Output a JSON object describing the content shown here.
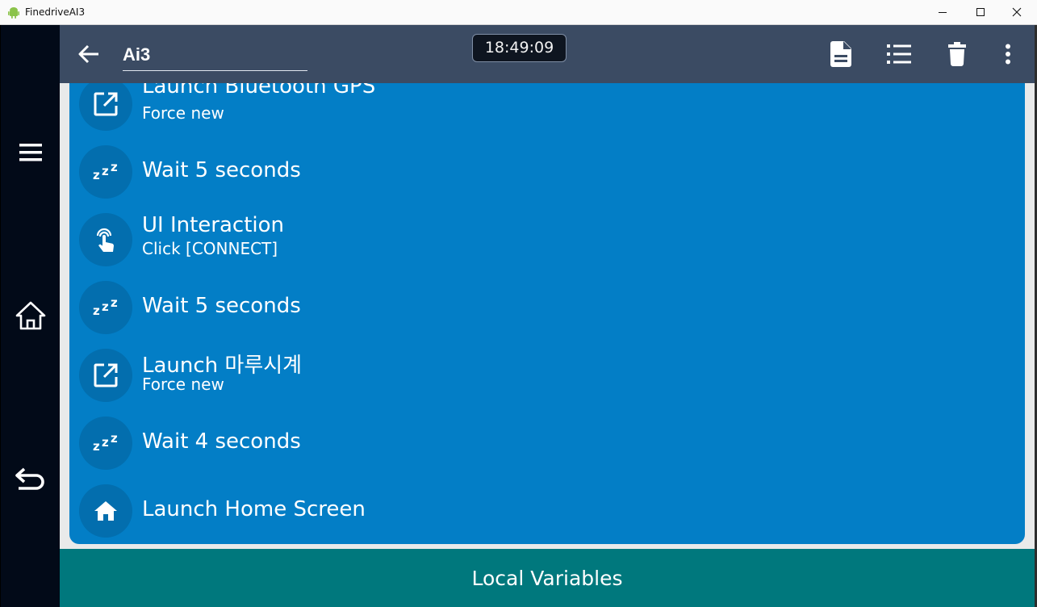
{
  "window": {
    "title": "FinedriveAI3",
    "icons": {
      "app": "android-icon",
      "minimize": "minimize-icon",
      "maximize": "maximize-icon",
      "close": "close-icon"
    }
  },
  "nav_rail": {
    "items": [
      {
        "icon": "menu-icon"
      },
      {
        "icon": "home-icon"
      },
      {
        "icon": "back-arrow-icon"
      }
    ]
  },
  "appbar": {
    "task_name": "Ai3",
    "clock": "18:49:09",
    "icons": [
      "back-arrow-icon",
      "document-icon",
      "list-icon",
      "trash-icon",
      "more-vert-icon"
    ]
  },
  "actions": [
    {
      "icon": "open-in-new-icon",
      "title": "Launch Bluetooth GPS",
      "subtitle": "Force new"
    },
    {
      "icon": "sleep-zzz-icon",
      "title": "Wait 5 seconds",
      "subtitle": ""
    },
    {
      "icon": "touch-icon",
      "title": "UI Interaction",
      "subtitle": "Click [CONNECT]"
    },
    {
      "icon": "sleep-zzz-icon",
      "title": "Wait 5 seconds",
      "subtitle": ""
    },
    {
      "icon": "open-in-new-icon",
      "title": "Launch 마루시계",
      "subtitle": "Force new"
    },
    {
      "icon": "sleep-zzz-icon",
      "title": "Wait 4 seconds",
      "subtitle": ""
    },
    {
      "icon": "home-icon",
      "title": "Launch Home Screen",
      "subtitle": ""
    }
  ],
  "bottom_bar": {
    "label": "Local Variables"
  },
  "colors": {
    "appbar": "#3b4b63",
    "action_card": "#037ec6",
    "action_icon_circle": "#036eae",
    "bottom_bar": "#00787d",
    "nav_rail": "#020a18"
  }
}
